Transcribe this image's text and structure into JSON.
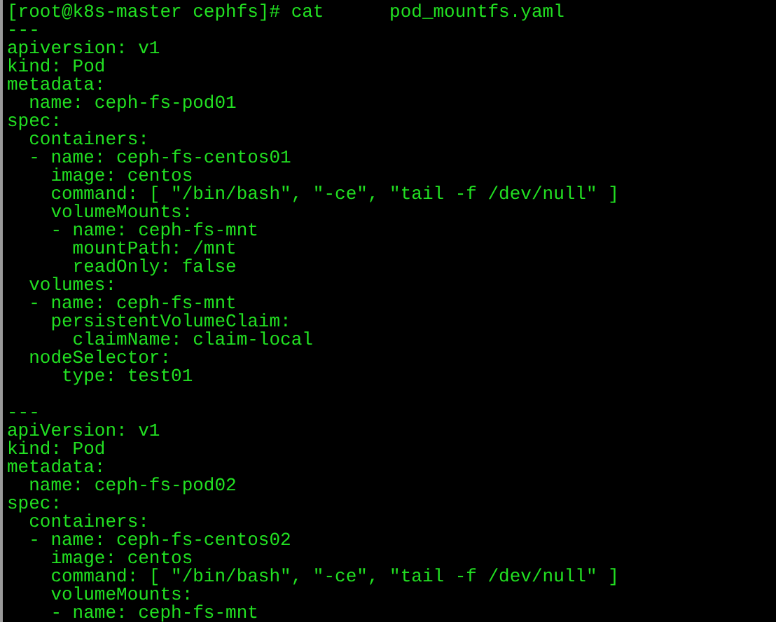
{
  "terminal": {
    "prompt": "[root@k8s-master cephfs]# cat      pod_mountfs.yaml",
    "documents": [
      {
        "separator": "---",
        "lines": [
          "apiversion: v1",
          "kind: Pod",
          "metadata:",
          "  name: ceph-fs-pod01",
          "spec:",
          "  containers:",
          "  - name: ceph-fs-centos01",
          "    image: centos",
          "    command: [ \"/bin/bash\", \"-ce\", \"tail -f /dev/null\" ]",
          "    volumeMounts:",
          "    - name: ceph-fs-mnt",
          "      mountPath: /mnt",
          "      readOnly: false",
          "  volumes:",
          "  - name: ceph-fs-mnt",
          "    persistentVolumeClaim:",
          "      claimName: claim-local",
          "  nodeSelector:",
          "     type: test01"
        ]
      },
      {
        "separator": "---",
        "lines": [
          "apiVersion: v1",
          "kind: Pod",
          "metadata:",
          "  name: ceph-fs-pod02",
          "spec:",
          "  containers:",
          "  - name: ceph-fs-centos02",
          "    image: centos",
          "    command: [ \"/bin/bash\", \"-ce\", \"tail -f /dev/null\" ]",
          "    volumeMounts:",
          "    - name: ceph-fs-mnt"
        ]
      }
    ]
  }
}
